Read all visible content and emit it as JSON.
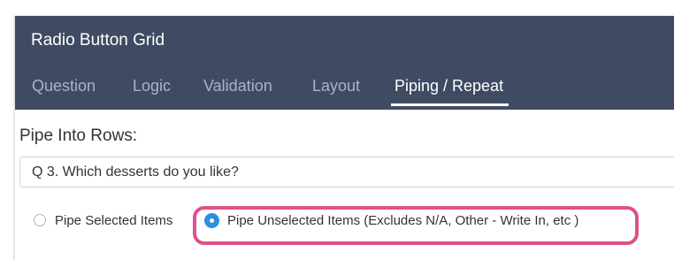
{
  "window": {
    "title": "Radio Button Grid"
  },
  "tabs": [
    {
      "label": "Question",
      "active": false
    },
    {
      "label": "Logic",
      "active": false
    },
    {
      "label": "Validation",
      "active": false
    },
    {
      "label": "Layout",
      "active": false
    },
    {
      "label": "Piping / Repeat",
      "active": true
    }
  ],
  "piping": {
    "section_label": "Pipe Into Rows:",
    "source_question": "Q 3. Which desserts do you like?",
    "options": [
      {
        "label": "Pipe Selected Items",
        "selected": false
      },
      {
        "label": "Pipe Unselected Items (Excludes N/A, Other - Write In, etc )",
        "selected": true
      }
    ]
  },
  "colors": {
    "header_bg": "#3f4a63",
    "tab_inactive": "#aab3c6",
    "tab_active": "#ffffff",
    "radio_checked": "#2d8fe0",
    "highlight_border": "#e0508a"
  },
  "icons": {
    "radio_unselected": "radio-unselected-icon",
    "radio_selected": "radio-selected-icon"
  }
}
